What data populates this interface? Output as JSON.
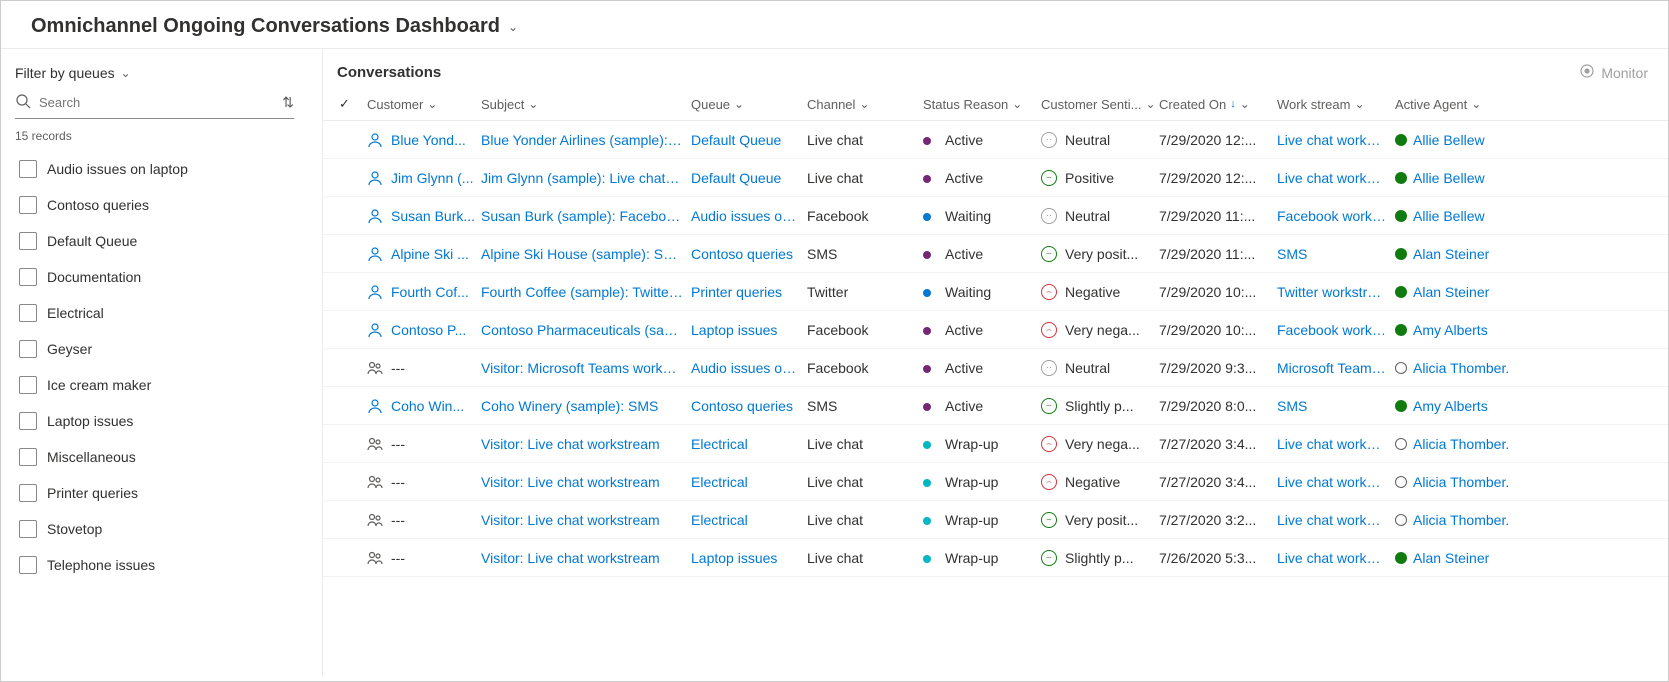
{
  "header": {
    "title": "Omnichannel Ongoing Conversations Dashboard"
  },
  "sidebar": {
    "filter_title": "Filter by queues",
    "search_placeholder": "Search",
    "record_count": "15 records",
    "queues": [
      {
        "label": "Audio issues on laptop"
      },
      {
        "label": "Contoso queries"
      },
      {
        "label": "Default Queue"
      },
      {
        "label": "Documentation"
      },
      {
        "label": "Electrical"
      },
      {
        "label": "Geyser"
      },
      {
        "label": "Ice cream maker"
      },
      {
        "label": "Laptop issues"
      },
      {
        "label": "Miscellaneous"
      },
      {
        "label": "Printer queries"
      },
      {
        "label": "Stovetop"
      },
      {
        "label": "Telephone issues"
      }
    ]
  },
  "content": {
    "title": "Conversations",
    "monitor": "Monitor",
    "columns": {
      "customer": "Customer",
      "subject": "Subject",
      "queue": "Queue",
      "channel": "Channel",
      "status": "Status Reason",
      "sentiment": "Customer Senti...",
      "created": "Created On",
      "workstream": "Work stream",
      "agent": "Active Agent"
    },
    "rows": [
      {
        "icon": "person",
        "customer": "Blue Yond...",
        "subject": "Blue Yonder Airlines (sample): Live c",
        "queue": "Default Queue",
        "channel": "Live chat",
        "status_dot": "purple",
        "status": "Active",
        "sent_face": "neutral",
        "sentiment": "Neutral",
        "created": "7/29/2020 12:...",
        "workstream": "Live chat workstrea",
        "agent_dot": "g",
        "agent": "Allie Bellew"
      },
      {
        "icon": "person",
        "customer": "Jim Glynn (...",
        "subject": "Jim Glynn (sample): Live chat works",
        "queue": "Default Queue",
        "channel": "Live chat",
        "status_dot": "purple",
        "status": "Active",
        "sent_face": "pos",
        "sentiment": "Positive",
        "created": "7/29/2020 12:...",
        "workstream": "Live chat workstrea",
        "agent_dot": "g",
        "agent": "Allie Bellew"
      },
      {
        "icon": "person",
        "customer": "Susan Burk...",
        "subject": "Susan Burk (sample): Facebook wor",
        "queue": "Audio issues on lap",
        "channel": "Facebook",
        "status_dot": "blue",
        "status": "Waiting",
        "sent_face": "neutral",
        "sentiment": "Neutral",
        "created": "7/29/2020 11:...",
        "workstream": "Facebook workstre",
        "agent_dot": "g",
        "agent": "Allie Bellew"
      },
      {
        "icon": "person",
        "customer": "Alpine Ski ...",
        "subject": "Alpine Ski House (sample): SMS",
        "queue": "Contoso queries",
        "channel": "SMS",
        "status_dot": "purple",
        "status": "Active",
        "sent_face": "pos",
        "sentiment": "Very posit...",
        "created": "7/29/2020 11:...",
        "workstream": "SMS",
        "agent_dot": "g",
        "agent": "Alan Steiner"
      },
      {
        "icon": "person",
        "customer": "Fourth Cof...",
        "subject": "Fourth Coffee (sample): Twitter wor",
        "queue": "Printer queries",
        "channel": "Twitter",
        "status_dot": "blue",
        "status": "Waiting",
        "sent_face": "neg",
        "sentiment": "Negative",
        "created": "7/29/2020 10:...",
        "workstream": "Twitter workstream",
        "agent_dot": "g",
        "agent": "Alan Steiner"
      },
      {
        "icon": "person",
        "customer": "Contoso P...",
        "subject": "Contoso Pharmaceuticals (sample):",
        "queue": "Laptop issues",
        "channel": "Facebook",
        "status_dot": "purple",
        "status": "Active",
        "sent_face": "neg",
        "sentiment": "Very nega...",
        "created": "7/29/2020 10:...",
        "workstream": "Facebook workstre",
        "agent_dot": "g",
        "agent": "Amy Alberts"
      },
      {
        "icon": "group",
        "customer": "---",
        "subject": "Visitor: Microsoft Teams workstrean",
        "queue": "Audio issues on lap",
        "channel": "Facebook",
        "status_dot": "purple",
        "status": "Active",
        "sent_face": "neutral",
        "sentiment": "Neutral",
        "created": "7/29/2020 9:3...",
        "workstream": "Microsoft Teams w",
        "agent_dot": "o",
        "agent": "Alicia Thomber."
      },
      {
        "icon": "person",
        "customer": "Coho Win...",
        "subject": "Coho Winery (sample): SMS",
        "queue": "Contoso queries",
        "channel": "SMS",
        "status_dot": "purple",
        "status": "Active",
        "sent_face": "pos",
        "sentiment": "Slightly p...",
        "created": "7/29/2020 8:0...",
        "workstream": "SMS",
        "agent_dot": "g",
        "agent": "Amy Alberts"
      },
      {
        "icon": "group",
        "customer": "---",
        "subject": "Visitor: Live chat workstream",
        "queue": "Electrical",
        "channel": "Live chat",
        "status_dot": "teal",
        "status": "Wrap-up",
        "sent_face": "neg",
        "sentiment": "Very nega...",
        "created": "7/27/2020 3:4...",
        "workstream": "Live chat workstrea",
        "agent_dot": "o",
        "agent": "Alicia Thomber."
      },
      {
        "icon": "group",
        "customer": "---",
        "subject": "Visitor: Live chat workstream",
        "queue": "Electrical",
        "channel": "Live chat",
        "status_dot": "teal",
        "status": "Wrap-up",
        "sent_face": "neg",
        "sentiment": "Negative",
        "created": "7/27/2020 3:4...",
        "workstream": "Live chat workstrea",
        "agent_dot": "o",
        "agent": "Alicia Thomber."
      },
      {
        "icon": "group",
        "customer": "---",
        "subject": "Visitor: Live chat workstream",
        "queue": "Electrical",
        "channel": "Live chat",
        "status_dot": "teal",
        "status": "Wrap-up",
        "sent_face": "pos",
        "sentiment": "Very posit...",
        "created": "7/27/2020 3:2...",
        "workstream": "Live chat workstrea",
        "agent_dot": "o",
        "agent": "Alicia Thomber."
      },
      {
        "icon": "group",
        "customer": "---",
        "subject": "Visitor: Live chat workstream",
        "queue": "Laptop issues",
        "channel": "Live chat",
        "status_dot": "teal",
        "status": "Wrap-up",
        "sent_face": "pos",
        "sentiment": "Slightly p...",
        "created": "7/26/2020 5:3...",
        "workstream": "Live chat workstrea",
        "agent_dot": "g",
        "agent": "Alan Steiner"
      }
    ]
  }
}
